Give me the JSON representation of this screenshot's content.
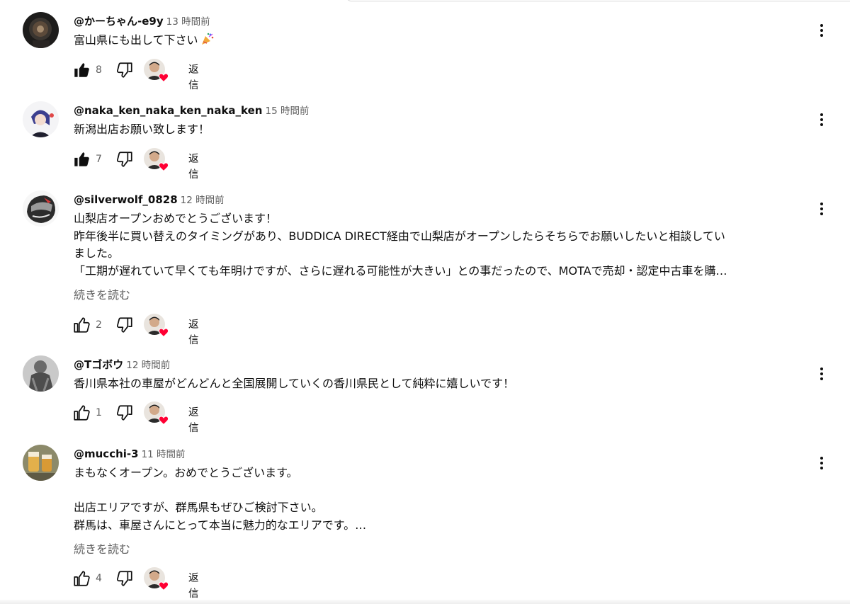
{
  "comments": [
    {
      "author": "@かーちゃん-e9y",
      "time": "13 時間前",
      "lines": [
        "富山県にも出して下さい"
      ],
      "has_emoji": true,
      "emoji_icon": "party-popper-icon",
      "likes": "8",
      "liked": true,
      "read_more": "",
      "reply": "返信"
    },
    {
      "author": "@naka_ken_naka_ken_naka_ken",
      "time": "15 時間前",
      "lines": [
        "新潟出店お願い致します！"
      ],
      "likes": "7",
      "liked": true,
      "read_more": "",
      "reply": "返信"
    },
    {
      "author": "@silverwolf_0828",
      "time": "12 時間前",
      "lines": [
        "山梨店オープンおめでとうございます！",
        "昨年後半に買い替えのタイミングがあり、BUDDICA DIRECT経由で山梨店がオープンしたらそちらでお願いしたいと相談してい",
        "ました。",
        "「工期が遅れていて早くても年明けですが、さらに遅れる可能性が大きい」との事だったので、MOTAで売却・認定中古車を購…"
      ],
      "likes": "2",
      "liked": false,
      "read_more": "続きを読む",
      "reply": "返信"
    },
    {
      "author": "@Tゴボウ",
      "time": "12 時間前",
      "lines": [
        "香川県本社の車屋がどんどんと全国展開していくの香川県民として純粋に嬉しいです！"
      ],
      "likes": "1",
      "liked": false,
      "read_more": "",
      "reply": "返信"
    },
    {
      "author": "@mucchi-3",
      "time": "11 時間前",
      "lines": [
        "まもなくオープン。おめでとうございます。",
        "",
        "出店エリアですが、群馬県もぜひご検討下さい。",
        "群馬は、車屋さんにとって本当に魅力的なエリアです。…"
      ],
      "likes": "4",
      "liked": false,
      "read_more": "続きを読む",
      "reply": "返信"
    }
  ],
  "colors": {
    "text": "#0f0f0f",
    "secondary": "#606060",
    "heart": "#ff0033"
  }
}
